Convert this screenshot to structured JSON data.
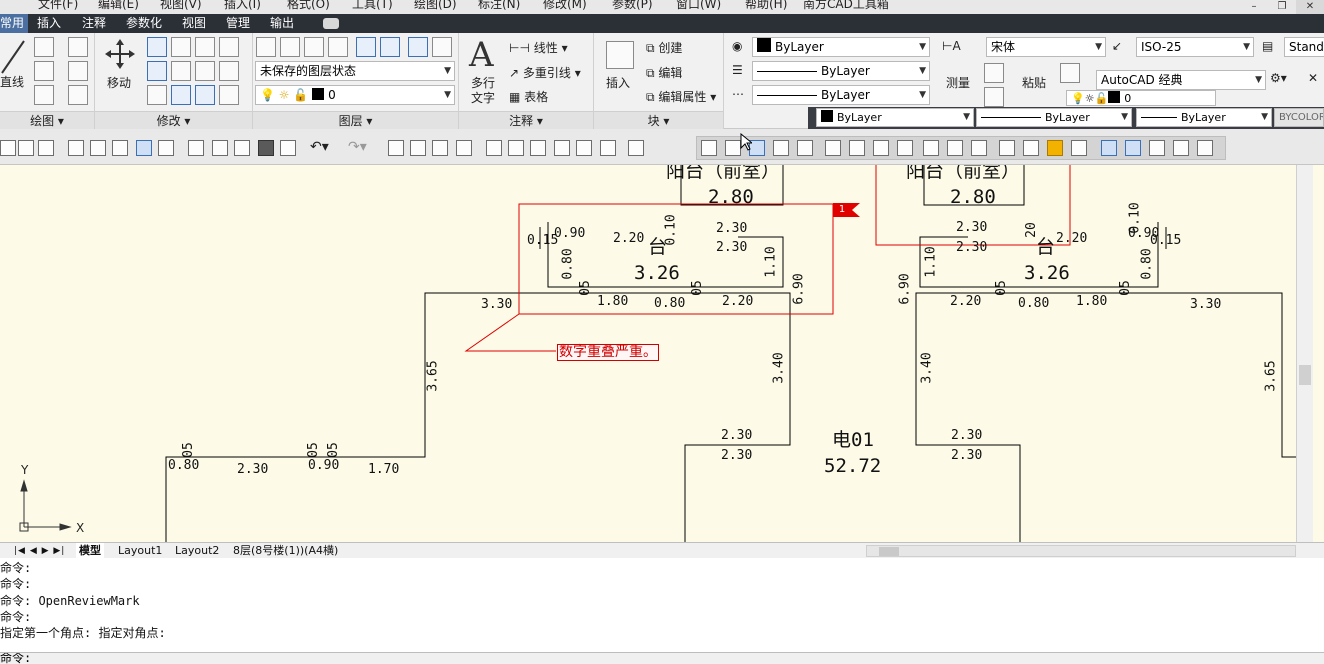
{
  "menu": [
    "文件(F)",
    "编辑(E)",
    "视图(V)",
    "插入(I)",
    "格式(O)",
    "工具(T)",
    "绘图(D)",
    "标注(N)",
    "修改(M)",
    "参数(P)",
    "窗口(W)",
    "帮助(H)",
    "南方CAD工具箱"
  ],
  "tabs": [
    "常用",
    "插入",
    "注释",
    "参数化",
    "视图",
    "管理",
    "输出"
  ],
  "ribbon": {
    "draw": {
      "line": "直线",
      "panel": "绘图"
    },
    "modify": {
      "move": "移动",
      "panel": "修改"
    },
    "layers": {
      "state": "未保存的图层状态",
      "current": "0",
      "panel": "图层"
    },
    "annotation": {
      "multiline_text": "多行",
      "text": "文字",
      "linear": "线性",
      "multileader": "多重引线",
      "table": "表格",
      "panel": "注释"
    },
    "block": {
      "insert": "插入",
      "create": "创建",
      "edit": "编辑",
      "edit_attr": "编辑属性",
      "panel": "块"
    },
    "properties": {
      "color": "ByLayer",
      "linetype": "ByLayer",
      "lineweight": "ByLayer"
    },
    "styles": {
      "font": "宋体",
      "dimstyle": "ISO-25",
      "tablestyle": "Standa",
      "measure": "测量",
      "paste": "粘贴",
      "workspace": "AutoCAD 经典",
      "layer_zero": "0"
    },
    "bar2": {
      "bylayer1": "ByLayer",
      "bylayer2": "ByLayer",
      "bylayer3": "ByLayer",
      "bycolor": "BYCOLOR"
    }
  },
  "drawing": {
    "room_title_left": "阳台（前室）",
    "room_title_right": "阳台（前室）",
    "room_area_left": "2.80",
    "room_area_right": "2.80",
    "area_left_mid": "3.26",
    "area_right_mid": "3.26",
    "elec_label": "电01",
    "elec_area": "52.72",
    "tai": "台",
    "review_note": "数字重叠严重。",
    "review_flag": "1",
    "dims": {
      "d230": "2.30",
      "d220": "2.20",
      "d180": "1.80",
      "d080": "0.80",
      "d330": "3.30",
      "d365": "3.65",
      "d340": "3.40",
      "d690": "6.90",
      "d170": "1.70",
      "d110": "1.10",
      "d005": "0.05",
      "d010": "0.10",
      "d090": "0.90",
      "d015": "0.15",
      "d20": "20",
      "d05": "05",
      "d10": "10"
    },
    "axis_x": "X",
    "axis_y": "Y"
  },
  "layout_tabs": [
    "模型",
    "Layout1",
    "Layout2",
    "8层(8号楼(1))(A4横)"
  ],
  "commands": [
    "命令:",
    "命令:",
    "命令: OpenReviewMark",
    "命令:",
    "指定第一个角点: 指定对角点:"
  ],
  "command_prompt": "命令:"
}
